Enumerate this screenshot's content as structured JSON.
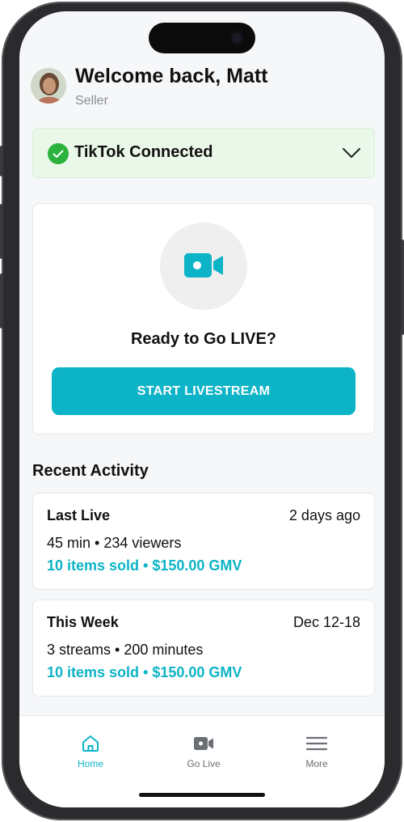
{
  "header": {
    "welcome": "Welcome back, Matt",
    "role": "Seller"
  },
  "connection": {
    "label": "TikTok Connected",
    "status_icon": "check-circle-icon",
    "toggle_icon": "chevron-down-icon"
  },
  "golive_card": {
    "icon": "video-camera-icon",
    "title": "Ready to Go LIVE?",
    "button_label": "START LIVESTREAM"
  },
  "recent_activity": {
    "title": "Recent Activity",
    "items": [
      {
        "title": "Last Live",
        "date": "2 days ago",
        "stats": "45 min • 234 viewers",
        "sales": "10 items sold • $150.00 GMV"
      },
      {
        "title": "This Week",
        "date": "Dec 12-18",
        "stats": "3 streams • 200 minutes",
        "sales": "10 items sold • $150.00 GMV"
      }
    ]
  },
  "tabbar": {
    "tabs": [
      {
        "label": "Home",
        "icon": "home-icon",
        "active": true
      },
      {
        "label": "Go Live",
        "icon": "video-camera-icon",
        "active": false
      },
      {
        "label": "More",
        "icon": "menu-icon",
        "active": false
      }
    ]
  },
  "colors": {
    "accent": "#0db4c7",
    "success": "#2bb33d",
    "connected_bg": "#eaf8e9",
    "inactive_tab": "#6b6e74",
    "background": "#f6f7f9"
  }
}
